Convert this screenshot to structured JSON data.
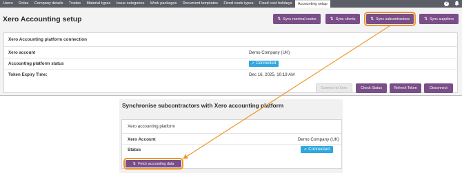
{
  "nav": {
    "tabs": [
      "Users",
      "Roles",
      "Company details",
      "Trades",
      "Material types",
      "Issue categories",
      "Work packages",
      "Document templates",
      "Fixed costs types",
      "Fixed cost holidays",
      "Accounting setup"
    ],
    "active_index": 10,
    "help_icon": "question-circle-icon",
    "notification_icon": "bell-icon"
  },
  "top": {
    "title": "Xero Accounting setup",
    "sync_buttons": [
      "Sync nominal codes",
      "Sync clients",
      "Sync subcontractors",
      "Sync suppliers"
    ],
    "highlighted_sync": "Sync subcontractors",
    "card": {
      "heading": "Xero Accounting platform connection",
      "rows": [
        {
          "label": "Xero account",
          "value": "Demo Company (UK)"
        },
        {
          "label": "Accounting platform status",
          "value": "Connected"
        },
        {
          "label": "Token Expiry Time:",
          "value": "Dec 16, 2025, 10:19 AM"
        }
      ],
      "actions": [
        "Connect to Xero",
        "Check Status",
        "Refresh Token",
        "Disconnect"
      ]
    }
  },
  "bottom": {
    "title": "Synchronise subcontractors with Xero accounting platform",
    "card": {
      "heading": "Xero accounting platform",
      "rows": [
        {
          "label": "Xero Account",
          "value": "Demo Company (UK)"
        },
        {
          "label": "Status",
          "value": "Connected"
        }
      ],
      "fetch_button": "Fetch accounting data"
    }
  },
  "colors": {
    "nav_bg": "#5b5e66",
    "primary": "#7a4e88",
    "badge": "#2ea8de",
    "highlight": "#f0962a"
  }
}
